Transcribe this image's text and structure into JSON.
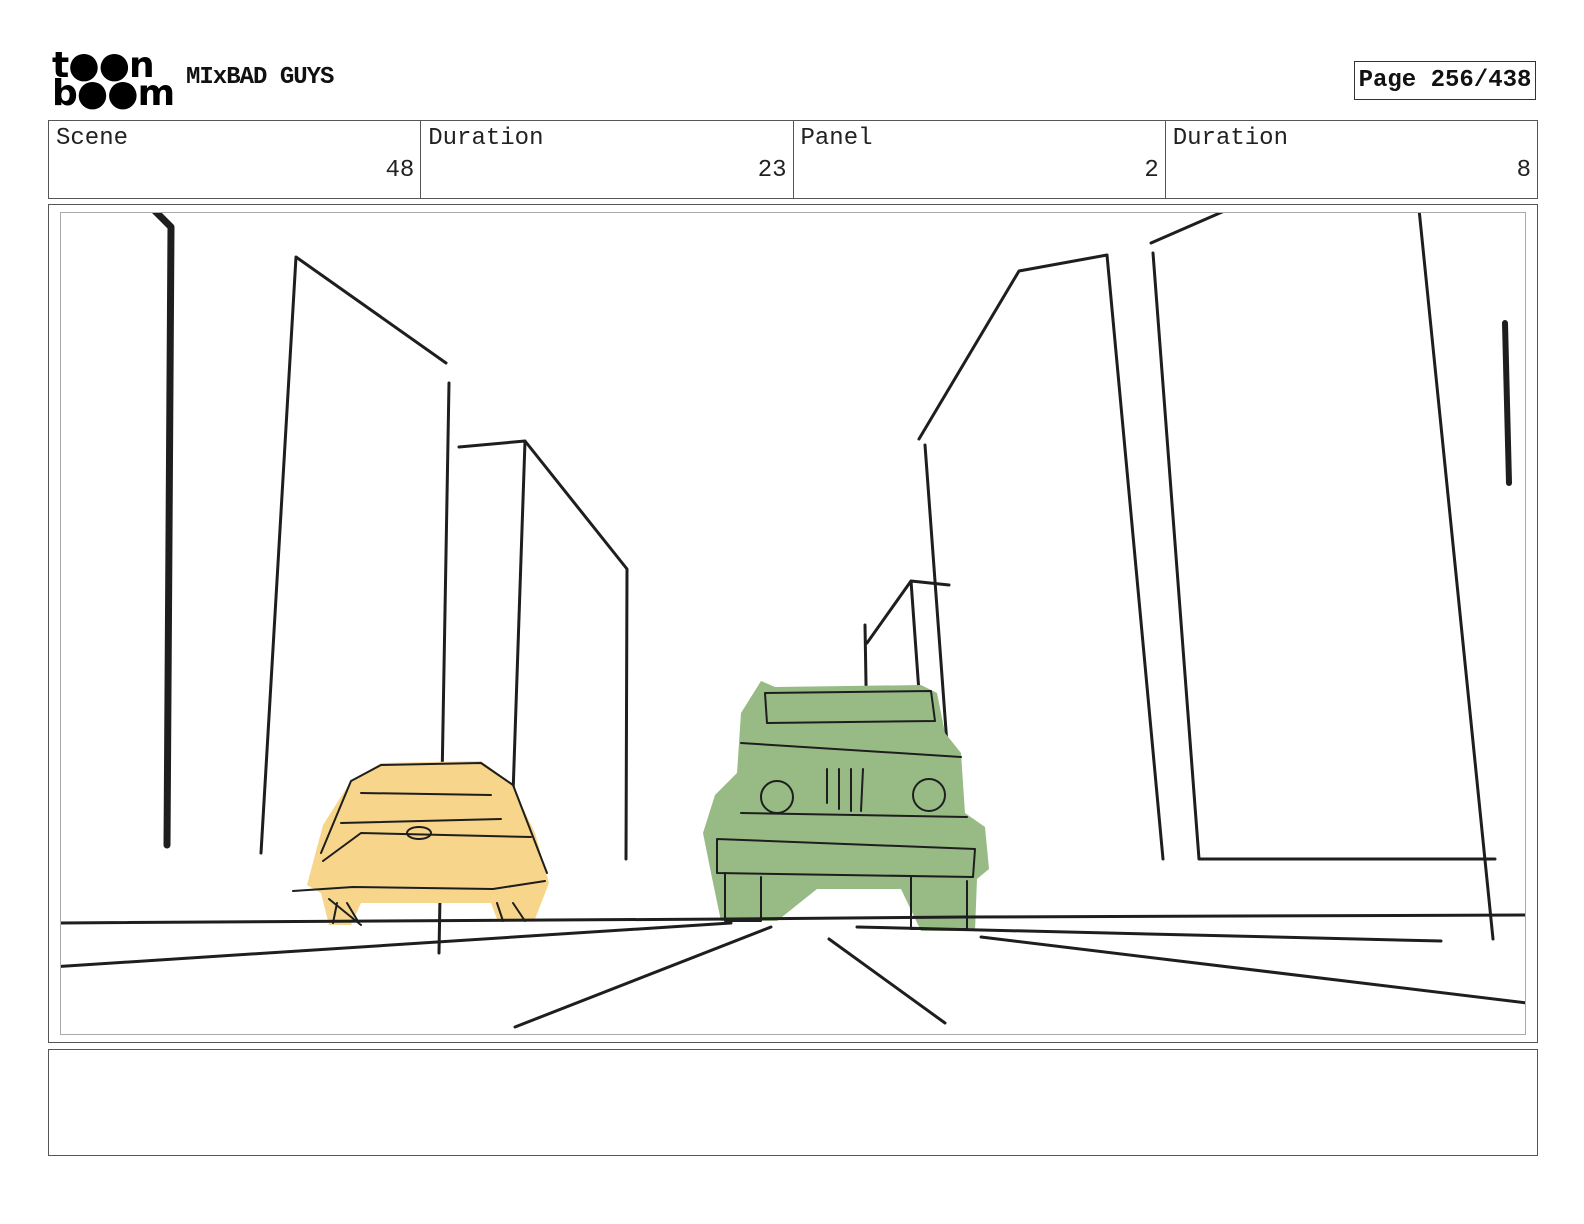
{
  "header": {
    "logo_line1": "t●●n",
    "logo_line2": "b●●m",
    "logo_brand": "toon boom",
    "project_title": "MIxBAD GUYS",
    "page_label": "Page 256/438"
  },
  "info": {
    "scene_label": "Scene",
    "scene_value": "48",
    "scene_duration_label": "Duration",
    "scene_duration_value": "23",
    "panel_label": "Panel",
    "panel_value": "2",
    "panel_duration_label": "Duration",
    "panel_duration_value": "8"
  },
  "colors": {
    "yellow_car": "#f7d58a",
    "green_jeep": "#98bb86",
    "ink": "#1e1e1e"
  },
  "notes": {
    "text": ""
  }
}
